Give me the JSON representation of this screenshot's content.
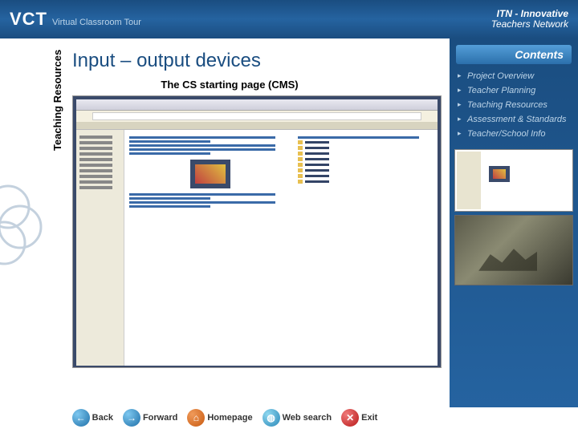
{
  "header": {
    "vct_abbrev": "VCT",
    "vct_sub": "Virtual Classroom Tour",
    "itn_line1": "ITN - Innovative",
    "itn_line2": "Teachers Network"
  },
  "page": {
    "title": "Input – output devices",
    "subtitle": "The CS starting page (CMS)",
    "vertical_tab": "Teaching Resources"
  },
  "right_panel": {
    "contents_label": "Contents",
    "items": [
      "Project Overview",
      "Teacher Planning",
      "Teaching Resources",
      "Assessment & Standards",
      "Teacher/School Info"
    ]
  },
  "footer": {
    "back": "Back",
    "forward": "Forward",
    "homepage": "Homepage",
    "websearch": "Web search",
    "exit": "Exit"
  }
}
